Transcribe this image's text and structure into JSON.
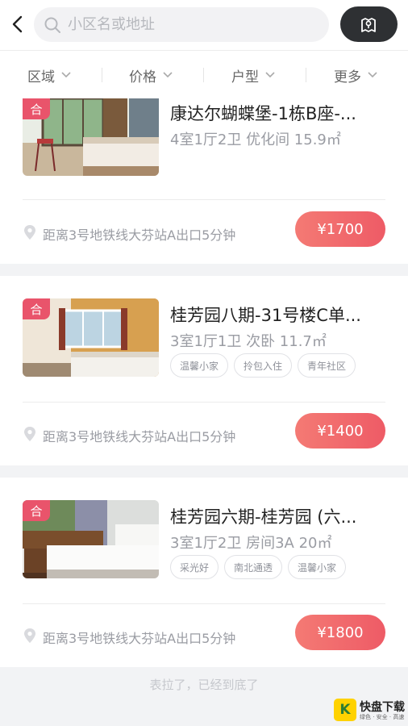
{
  "search": {
    "placeholder": "小区名或地址"
  },
  "filters": [
    {
      "label": "区域"
    },
    {
      "label": "价格"
    },
    {
      "label": "户型"
    },
    {
      "label": "更多"
    }
  ],
  "listings": [
    {
      "badge": "合",
      "title": "康达尔蝴蝶堡-1栋B座-...",
      "meta": "4室1厅2卫 优化间 15.9㎡",
      "tags": [],
      "location": "距离3号地铁线大芬站A出口5分钟",
      "price": "¥1700"
    },
    {
      "badge": "合",
      "title": "桂芳园八期-31号楼C单...",
      "meta": "3室1厅1卫 次卧 11.7㎡",
      "tags": [
        "温馨小家",
        "拎包入住",
        "青年社区"
      ],
      "location": "距离3号地铁线大芬站A出口5分钟",
      "price": "¥1400"
    },
    {
      "badge": "合",
      "title": "桂芳园六期-桂芳园 (六...",
      "meta": "3室1厅2卫 房间3A 20㎡",
      "tags": [
        "采光好",
        "南北通透",
        "温馨小家"
      ],
      "location": "距离3号地铁线大芬站A出口5分钟",
      "price": "¥1800"
    }
  ],
  "footer_text": "表拉了，已经到底了",
  "watermark": {
    "mark": "K",
    "title": "快盘下载",
    "subtitle": "绿色 · 安全 · 高速"
  }
}
